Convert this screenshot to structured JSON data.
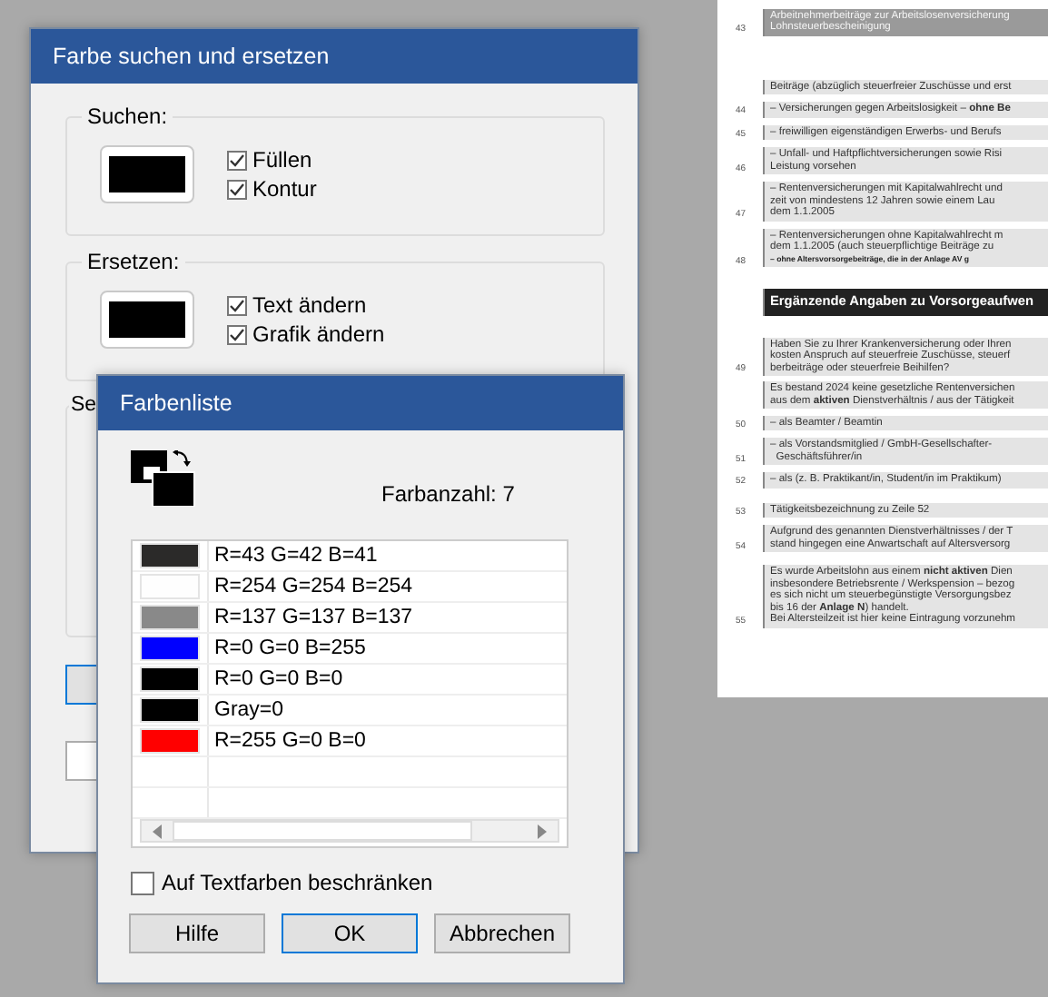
{
  "find_replace_dialog": {
    "title": "Farbe suchen und ersetzen",
    "groups": [
      {
        "label": "Suchen:",
        "color": "#000000",
        "options": [
          {
            "label": "Füllen",
            "checked": true
          },
          {
            "label": "Kontur",
            "checked": true
          }
        ]
      },
      {
        "label": "Ersetzen:",
        "color": "#000000",
        "options": [
          {
            "label": "Text ändern",
            "checked": true
          },
          {
            "label": "Grafik ändern",
            "checked": true
          }
        ]
      },
      {
        "label": "Se"
      }
    ]
  },
  "color_list_dialog": {
    "title": "Farbenliste",
    "count_label": "Farbanzahl: 7",
    "colors": [
      {
        "color": "#2b2a29",
        "label": "R=43 G=42 B=41"
      },
      {
        "color": "#fefefe",
        "label": "R=254 G=254 B=254"
      },
      {
        "color": "#898989",
        "label": "R=137 G=137 B=137"
      },
      {
        "color": "#0000ff",
        "label": "R=0 G=0 B=255"
      },
      {
        "color": "#000000",
        "label": "R=0 G=0 B=0"
      },
      {
        "color": "#000000",
        "label": "Gray=0"
      },
      {
        "color": "#ff0000",
        "label": "R=255 G=0 B=0"
      }
    ],
    "restrict": {
      "label": "Auf Textfarben beschränken",
      "checked": false
    },
    "buttons": [
      {
        "label": "Hilfe",
        "default": false
      },
      {
        "label": "OK",
        "default": true
      },
      {
        "label": "Abbrechen",
        "default": false
      }
    ]
  },
  "document": {
    "rows": [
      {
        "kind": "header",
        "number": "43",
        "lines": [
          "Arbeitnehmerbeiträge zur Arbeitslosenversicherung",
          "Lohnsteuerbescheinigung"
        ]
      },
      {
        "kind": "intro",
        "lines": [
          "Beiträge (abzüglich steuerfreier Zuschüsse und erst"
        ]
      },
      {
        "kind": "item",
        "number": "44",
        "lines": [
          "– Versicherungen gegen Arbeitslosigkeit – **ohne Be**"
        ]
      },
      {
        "kind": "item",
        "number": "45",
        "lines": [
          "– freiwilligen eigenständigen Erwerbs- und Berufs"
        ]
      },
      {
        "kind": "item",
        "number": "46",
        "lines": [
          "– Unfall- und Haftpflichtversicherungen sowie Risi",
          "Leistung vorsehen"
        ]
      },
      {
        "kind": "item",
        "number": "47",
        "lines": [
          "– Rentenversicherungen mit Kapitalwahlrecht und",
          "zeit von mindestens 12 Jahren sowie einem Lau",
          "dem 1.1.2005"
        ]
      },
      {
        "kind": "item",
        "number": "48",
        "lines": [
          "– Rentenversicherungen ohne Kapitalwahlrecht m",
          "dem 1.1.2005 (auch steuerpflichtige Beiträge zu"
        ],
        "subnote": "– ohne Altersvorsorgebeiträge, die in der Anlage AV g"
      },
      {
        "kind": "section",
        "lines": [
          "Ergänzende Angaben zu Vorsorgeaufwen"
        ]
      },
      {
        "kind": "question",
        "number": "49",
        "lines": [
          "Haben Sie zu Ihrer Krankenversicherung oder Ihren",
          "kosten Anspruch auf steuerfreie Zuschüsse, steuerf",
          "berbeiträge oder steuerfreie Beihilfen?"
        ]
      },
      {
        "kind": "intro2",
        "lines": [
          "Es bestand 2024 keine gesetzliche Rentenversichen",
          "aus dem **aktiven** Dienstverhältnis / aus der Tätigkeit"
        ]
      },
      {
        "kind": "item",
        "number": "50",
        "lines": [
          "– als Beamter / Beamtin"
        ]
      },
      {
        "kind": "item",
        "number": "51",
        "lines": [
          "– als Vorstandsmitglied / GmbH-Gesellschafter-",
          "  Geschäftsführer/in"
        ]
      },
      {
        "kind": "item",
        "number": "52",
        "lines": [
          "– als (z. B. Praktikant/in, Student/in im Praktikum)"
        ]
      },
      {
        "kind": "field",
        "number": "53",
        "lines": [
          "Tätigkeitsbezeichnung zu Zeile 52"
        ]
      },
      {
        "kind": "item",
        "number": "54",
        "lines": [
          "Aufgrund des genannten Dienstverhältnisses / der T",
          "stand hingegen eine Anwartschaft auf Altersversorg"
        ]
      },
      {
        "kind": "note",
        "number": "55",
        "lines": [
          "Es wurde Arbeitslohn aus einem **nicht aktiven** Dien",
          "insbesondere Betriebsrente / Werkspension – bezog",
          "es sich nicht um steuerbegünstigte Versorgungsbez",
          "bis 16 der **Anlage N**) handelt.",
          "Bei Altersteilzeit ist hier keine Eintragung vorzunehm"
        ]
      }
    ]
  }
}
